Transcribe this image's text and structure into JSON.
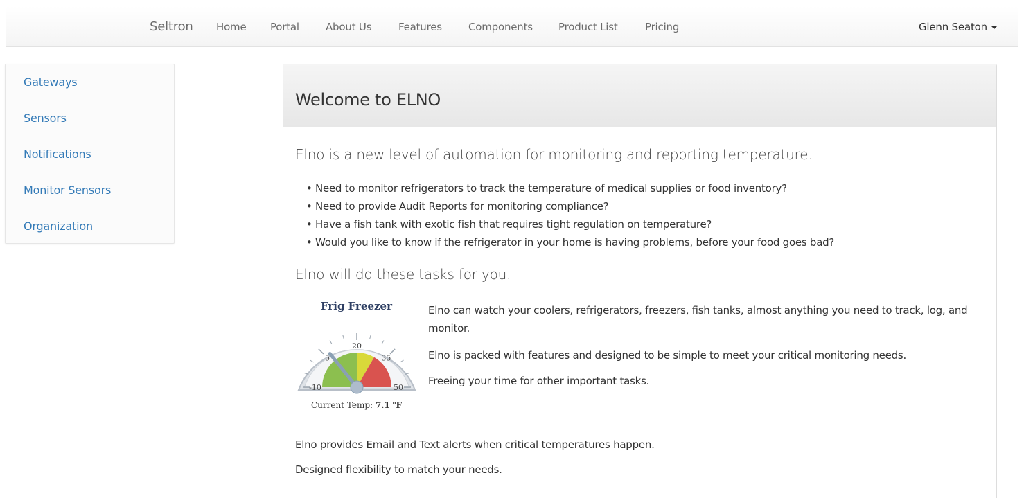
{
  "navbar": {
    "brand": "Seltron",
    "items": [
      "Home",
      "Portal",
      "About Us",
      "Features",
      "Components",
      "Product List",
      "Pricing"
    ],
    "user": "Glenn Seaton"
  },
  "sidebar": {
    "items": [
      "Gateways",
      "Sensors",
      "Notifications",
      "Monitor Sensors",
      "Organization"
    ]
  },
  "panel": {
    "title": "Welcome to ELNO",
    "lead": "Elno is a new level of automation for monitoring and reporting temperature.",
    "bullets": [
      "Need to monitor refrigerators to track the temperature of medical supplies or food inventory?",
      "Need to provide Audit Reports for monitoring compliance?",
      "Have a fish tank with exotic fish that requires tight regulation on temperature?",
      "Would you like to know if the refrigerator in your home is having problems, before your food goes bad?"
    ],
    "sub_lead": "Elno will do these tasks for you.",
    "gauge": {
      "title": "Frig Freezer",
      "ticks": [
        "-10",
        "5",
        "20",
        "35",
        "50"
      ],
      "min": -10,
      "max": 50,
      "value": 7.1,
      "temp_label": "Current Temp:",
      "temp_value": "7.1",
      "temp_unit": "℉",
      "colors": {
        "green": "#8cbf4f",
        "yellow": "#d9d93a",
        "red": "#d9534f",
        "needle": "#8aa0b4"
      }
    },
    "features": [
      "Elno can watch your coolers, refrigerators, freezers, fish tanks, almost anything you need to track, log, and monitor.",
      "Elno is packed with features and designed to be simple to meet your critical monitoring needs.",
      "Freeing your time for other important tasks."
    ],
    "footer_lines": [
      "Elno provides Email and Text alerts when critical temperatures happen.",
      "Designed flexibility to match your needs."
    ]
  },
  "colors": {
    "link": "#337ab7",
    "nav_text": "#6b6b6b"
  }
}
